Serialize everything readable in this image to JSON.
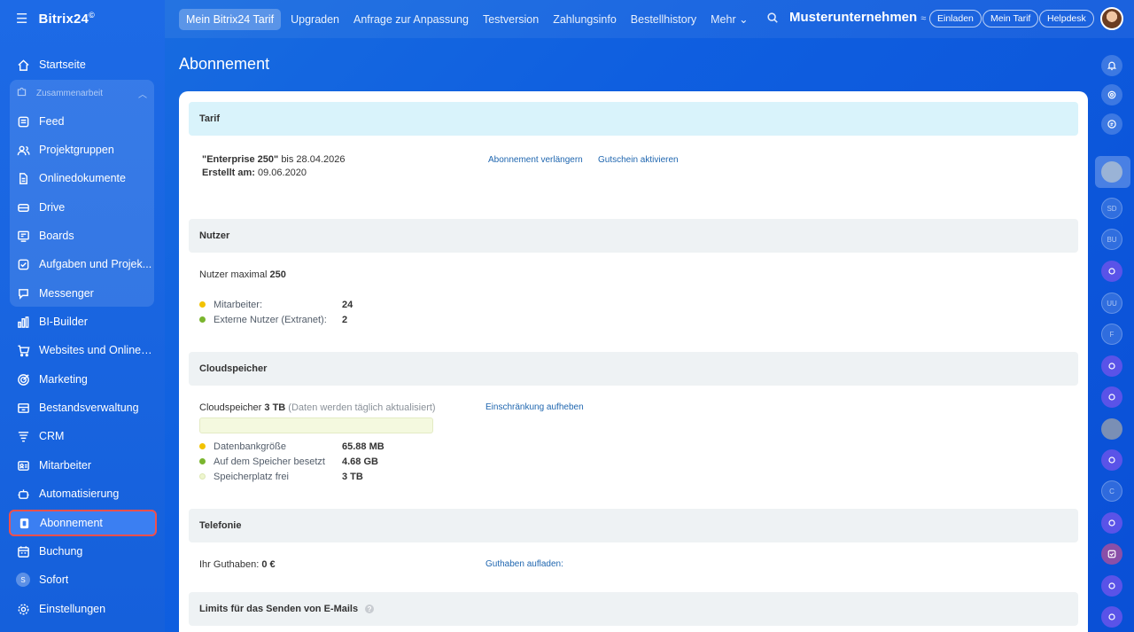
{
  "sidebar": {
    "logo": "Bitrix24",
    "logo_mark": "©",
    "group_label": "Zusammenarbeit",
    "items": [
      {
        "label": "Startseite"
      },
      {
        "label": "Feed"
      },
      {
        "label": "Projektgruppen"
      },
      {
        "label": "Onlinedokumente"
      },
      {
        "label": "Drive"
      },
      {
        "label": "Boards"
      },
      {
        "label": "Aufgaben und Projek..."
      },
      {
        "label": "Messenger"
      },
      {
        "label": "BI-Builder"
      },
      {
        "label": "Websites und Onlines..."
      },
      {
        "label": "Marketing"
      },
      {
        "label": "Bestandsverwaltung"
      },
      {
        "label": "CRM"
      },
      {
        "label": "Mitarbeiter"
      },
      {
        "label": "Automatisierung"
      },
      {
        "label": "Abonnement"
      },
      {
        "label": "Buchung"
      },
      {
        "label": "Sofort",
        "badge": "S"
      },
      {
        "label": "Einstellungen"
      }
    ]
  },
  "topbar": {
    "tabs": [
      "Mein Bitrix24 Tarif",
      "Upgraden",
      "Anfrage zur Anpassung",
      "Testversion",
      "Zahlungsinfo",
      "Bestellhistory",
      "Mehr ⌄"
    ],
    "company": "Musterunternehmen",
    "company_switch": "≈",
    "invite": "Einladen",
    "my_plan": "Mein Tarif",
    "helpdesk": "Helpdesk"
  },
  "page": {
    "title": "Abonnement"
  },
  "tarif": {
    "heading": "Tarif",
    "plan_name": "\"Enterprise 250\"",
    "until_label": "bis 28.04.2026",
    "created_label": "Erstellt am:",
    "created_value": "09.06.2020",
    "renew_link": "Abonnement verlängern",
    "voucher_link": "Gutschein aktivieren"
  },
  "users": {
    "heading": "Nutzer",
    "max_label": "Nutzer maximal",
    "max_value": "250",
    "employees_label": "Mitarbeiter:",
    "employees_value": "24",
    "external_label": "Externe Nutzer (Extranet):",
    "external_value": "2"
  },
  "cloud": {
    "heading": "Cloudspeicher",
    "label": "Cloudspeicher",
    "size": "3 TB",
    "note": "(Daten werden täglich aktualisiert)",
    "remove_limit_link": "Einschränkung aufheben",
    "db_label": "Datenbankgröße",
    "db_value": "65.88 MB",
    "used_label": "Auf dem Speicher besetzt",
    "used_value": "4.68 GB",
    "free_label": "Speicherplatz frei",
    "free_value": "3 TB"
  },
  "telephony": {
    "heading": "Telefonie",
    "balance_label": "Ihr Guthaben:",
    "balance_value": "0 €",
    "topup_link": "Guthaben aufladen:"
  },
  "email_limits": {
    "heading": "Limits für das Senden von E-Mails"
  },
  "rail": {
    "avatars": [
      "SD",
      "BU",
      "UU",
      "F",
      "C"
    ]
  },
  "colors": {
    "accent_blue": "#1560db",
    "link": "#2067b0",
    "bullet_yellow": "#f2c200",
    "bullet_green": "#7ab52e",
    "bullet_pale": "#eef6cf",
    "active_outline": "#f0504c"
  }
}
